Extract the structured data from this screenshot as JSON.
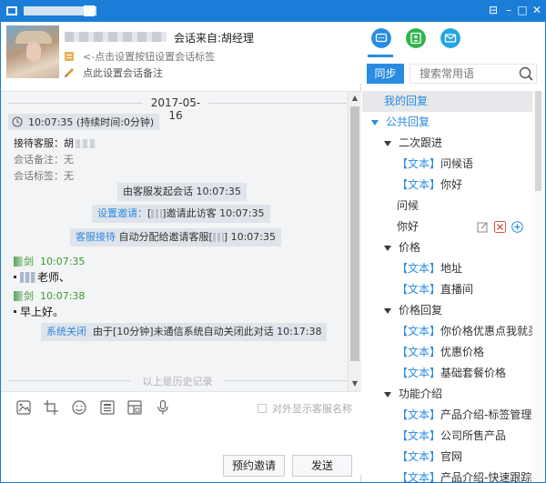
{
  "window": {
    "controls": [
      "minimize-icon",
      "maximize-icon",
      "close-icon"
    ]
  },
  "header": {
    "session_source": "会话来自:胡经理",
    "tag_hint": "<-点击设置按钮设置会话标签",
    "note_hint": "点此设置会话备注"
  },
  "chat": {
    "date": "2017-05-16",
    "session_time": "10:07:35 (持续时间:0分钟)",
    "receptionist_label": "接待客服：",
    "receptionist_value": "胡",
    "note_label": "会话备注：无",
    "tag_label": "会话标签：无",
    "events": [
      {
        "text": "由客服发起会话 10:07:35"
      },
      {
        "link": "设置邀请：",
        "text": "[",
        "text2": "]邀请此访客 10:07:35"
      },
      {
        "link": "客服接待",
        "text": "自动分配给邀请客服[",
        "text2": "] 10:07:35"
      }
    ],
    "messages": [
      {
        "name": "剑",
        "time": "10:07:35",
        "text": "老师、"
      },
      {
        "name": "剑",
        "time": "10:07:38",
        "text": "早上好。"
      }
    ],
    "close_event": {
      "link": "系统关闭",
      "text": "由于[10分钟]未通信系统自动关闭此对话 10:17:38"
    },
    "history_label": "以上是历史记录"
  },
  "toolbar": {
    "tools": [
      "image-icon",
      "crop-icon",
      "emoji-icon",
      "contact-card-icon",
      "screenshot-icon",
      "microphone-icon"
    ],
    "external_label": "对外显示客服名称"
  },
  "buttons": {
    "invite": "预约邀请",
    "send": "发送"
  },
  "right": {
    "tabs": [
      "chat-icon",
      "contacts-icon",
      "mail-icon"
    ],
    "sync": "同步",
    "search_placeholder": "搜索常用语",
    "my_replies": "我的回复",
    "public_replies": "公共回复",
    "groups": [
      {
        "name": "二次跟进",
        "items": [
          {
            "tag": "【文本】",
            "text": "问候语"
          },
          {
            "tag": "【文本】",
            "text": "你好"
          }
        ],
        "plain": [
          "问候",
          "你好"
        ]
      },
      {
        "name": "价格",
        "items": [
          {
            "tag": "【文本】",
            "text": "地址"
          },
          {
            "tag": "【文本】",
            "text": "直播间"
          }
        ]
      },
      {
        "name": "价格回复",
        "items": [
          {
            "tag": "【文本】",
            "text": "你价格优惠点我就买"
          },
          {
            "tag": "【文本】",
            "text": "优惠价格"
          },
          {
            "tag": "【文本】",
            "text": "基础套餐价格"
          }
        ]
      },
      {
        "name": "功能介绍",
        "items": [
          {
            "tag": "【文本】",
            "text": "产品介绍-标签管理"
          },
          {
            "tag": "【文本】",
            "text": "公司所售产品"
          },
          {
            "tag": "【文本】",
            "text": "官网"
          },
          {
            "tag": "【文本】",
            "text": "产品介绍-快速跟踪"
          }
        ]
      }
    ]
  }
}
